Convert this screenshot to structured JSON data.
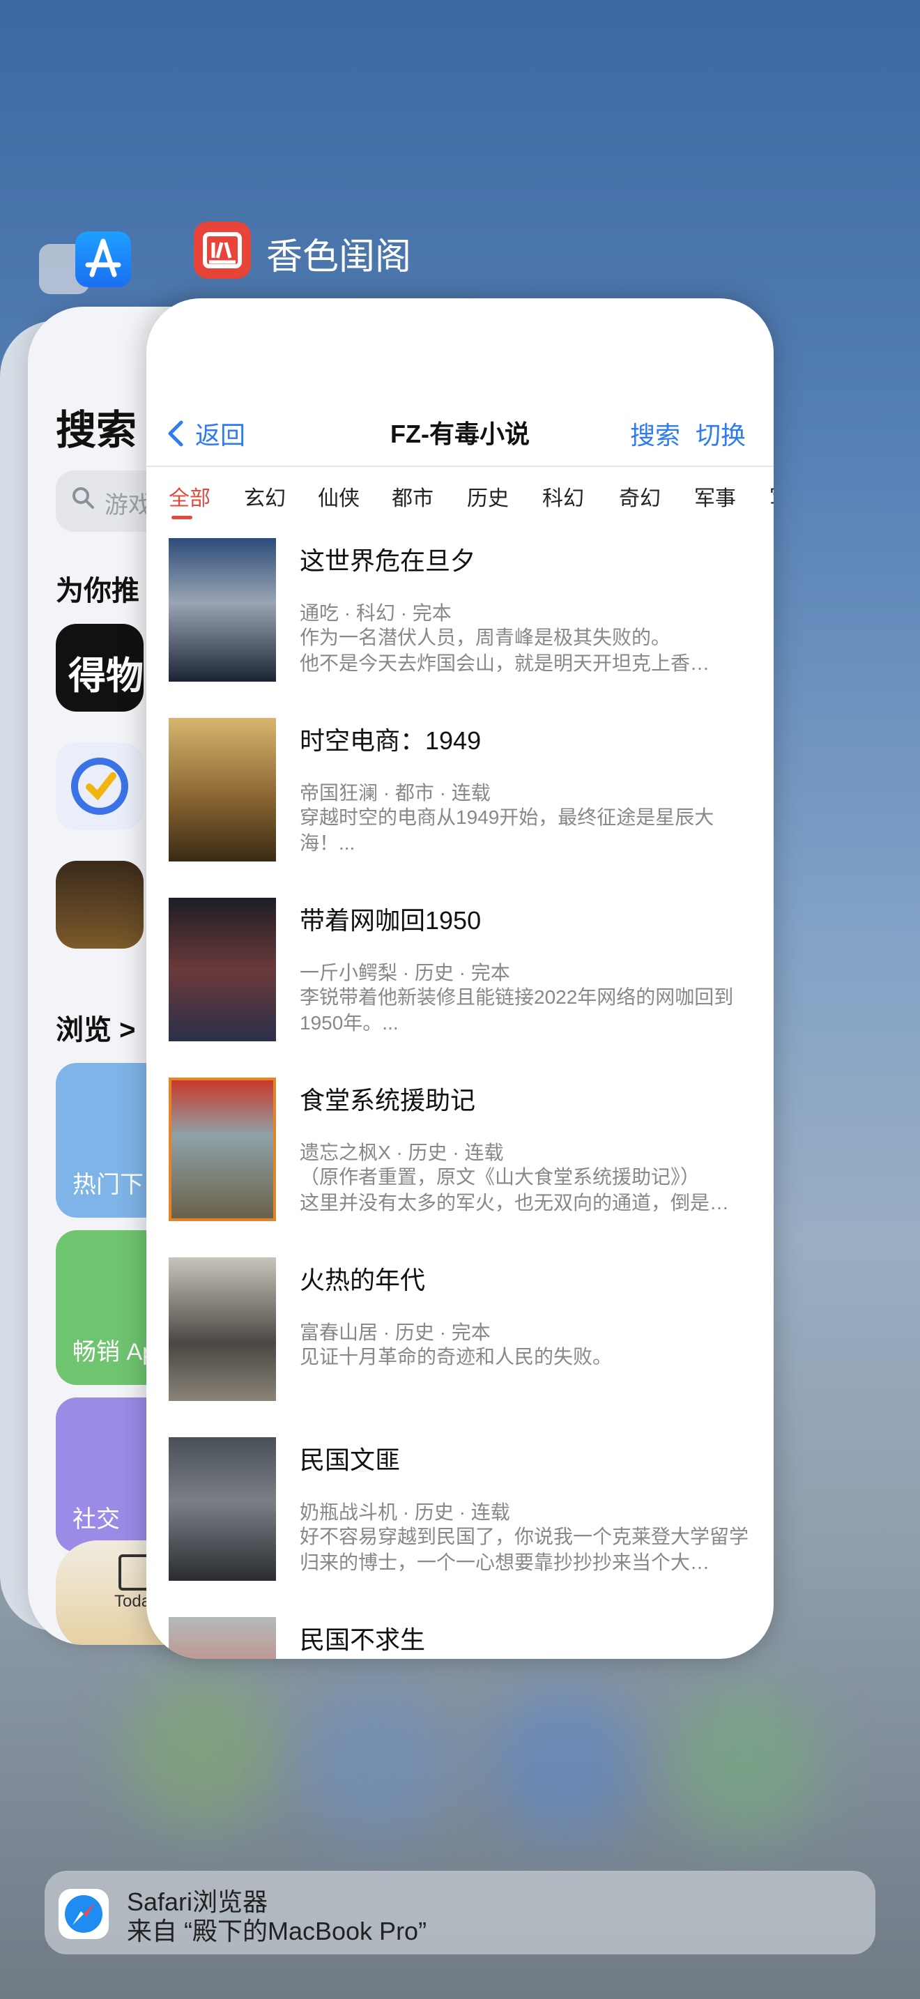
{
  "app_switcher": {
    "front_app_name": "香色闺阁",
    "banner": {
      "title": "Safari浏览器",
      "subtitle": "来自 “殿下的MacBook Pro”"
    }
  },
  "background_card": {
    "title": "搜索",
    "search_placeholder": "游戏",
    "section_recommend": "为你推",
    "section_browse": "浏览 >",
    "tiles": [
      "热门下",
      "畅销 Ap",
      "社交"
    ],
    "tabbar_today": "Toda"
  },
  "front_card": {
    "nav": {
      "back_label": "返回",
      "title": "FZ-有毒小说",
      "search_label": "搜索",
      "switch_label": "切换"
    },
    "tabs": [
      "全部",
      "玄幻",
      "仙侠",
      "都市",
      "历史",
      "科幻",
      "奇幻",
      "军事"
    ],
    "active_tab": "全部",
    "books": [
      {
        "title": "这世界危在旦夕",
        "meta": "通吃 · 科幻 · 完本",
        "desc": "作为一名潜伏人员，周青峰是极其失败的。\n 他不是今天去炸国会山，就是明天开坦克上香…"
      },
      {
        "title": "时空电商：1949",
        "meta": "帝国狂澜 · 都市 · 连载",
        "desc": "穿越时空的电商从1949开始，最终征途是星辰大海！..."
      },
      {
        "title": "带着网咖回1950",
        "meta": "一斤小鳄梨 · 历史 · 完本",
        "desc": "李锐带着他新装修且能链接2022年网络的网咖回到1950年。..."
      },
      {
        "title": "食堂系统援助记",
        "meta": "遗忘之枫X · 历史 · 连载",
        "desc": "（原作者重置，原文《山大食堂系统援助记》）\n这里并没有太多的军火，也无双向的通道，倒是…"
      },
      {
        "title": "火热的年代",
        "meta": "富春山居 · 历史 · 完本",
        "desc": "见证十月革命的奇迹和人民的失败。"
      },
      {
        "title": "民国文匪",
        "meta": "奶瓶战斗机 · 历史 · 连载",
        "desc": "好不容易穿越到民国了，你说我一个克莱登大学留学归来的博士，一个一心想要靠抄抄抄来当个大…"
      },
      {
        "title": "民国不求生",
        "meta": "",
        "desc": ""
      }
    ]
  }
}
